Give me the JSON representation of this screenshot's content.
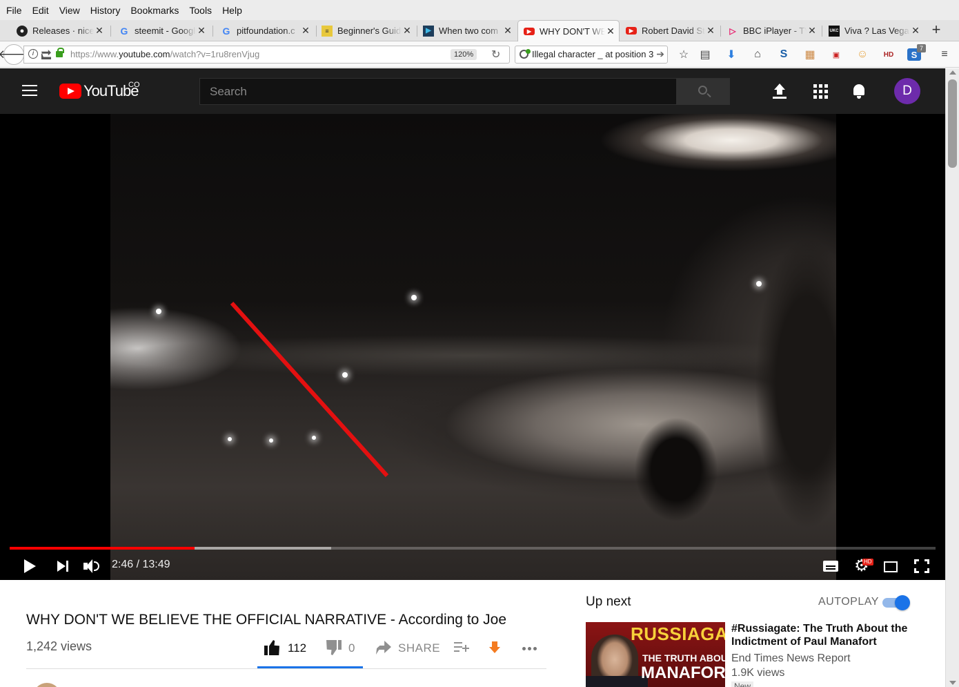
{
  "browser": {
    "menu": [
      "File",
      "Edit",
      "View",
      "History",
      "Bookmarks",
      "Tools",
      "Help"
    ],
    "tabs": [
      {
        "label": "Releases · niceh",
        "icon": "github-icon",
        "active": false
      },
      {
        "label": "steemit - Googl",
        "icon": "google-icon",
        "active": false
      },
      {
        "label": "pitfoundation.c",
        "icon": "google-icon",
        "active": false
      },
      {
        "label": "Beginner's Guid",
        "icon": "doc-icon",
        "active": false
      },
      {
        "label": "When two com",
        "icon": "play-icon",
        "active": false
      },
      {
        "label": "WHY DON'T WE",
        "icon": "youtube-icon",
        "active": true
      },
      {
        "label": "Robert David St",
        "icon": "youtube-icon",
        "active": false
      },
      {
        "label": "BBC iPlayer - TV",
        "icon": "iplayer-icon",
        "active": false
      },
      {
        "label": "Viva ? Las Vega",
        "icon": "ukc-icon",
        "active": false
      }
    ],
    "url_prefix": "https://www.",
    "url_domain": "youtube.com",
    "url_path": "/watch?v=1ru8renVjug",
    "zoom": "120%",
    "search_text": "Illegal character _ at position 3",
    "badge_count": "7"
  },
  "youtube": {
    "logo_text": "YouTube",
    "country": "CO",
    "search_placeholder": "Search",
    "avatar_letter": "D"
  },
  "player": {
    "current_time": "2:46",
    "duration": "13:49",
    "time_display": "2:46 / 13:49",
    "played_fraction": 0.2,
    "buffered_fraction": 0.347,
    "hd_badge": "HD"
  },
  "video": {
    "title": "WHY DON'T WE BELIEVE THE OFFICIAL NARRATIVE - According to Joe",
    "views": "1,242 views",
    "likes": "112",
    "dislikes": "0",
    "share_label": "SHARE"
  },
  "sidebar": {
    "up_next_label": "Up next",
    "autoplay_label": "AUTOPLAY",
    "autoplay_on": true,
    "recommendations": [
      {
        "title": "#Russiagate: The Truth About the Indictment of Paul Manafort",
        "channel": "End Times News Report",
        "views": "1.9K views",
        "badge": "New",
        "thumb_line1": "RUSSIAGATE",
        "thumb_line2": "THE TRUTH ABOUT",
        "thumb_line3": "MANAFORT"
      }
    ]
  }
}
